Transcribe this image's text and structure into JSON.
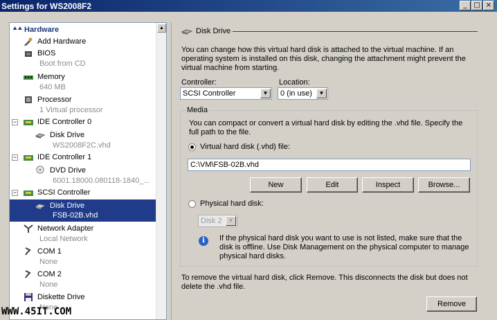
{
  "window": {
    "title": "Settings for WS2008F2"
  },
  "sidebar": {
    "header": "Hardware",
    "items": [
      {
        "label": "Add Hardware",
        "sub": ""
      },
      {
        "label": "BIOS",
        "sub": "Boot from CD"
      },
      {
        "label": "Memory",
        "sub": "640 MB"
      },
      {
        "label": "Processor",
        "sub": "1 Virtual processor"
      },
      {
        "label": "IDE Controller 0",
        "sub": ""
      },
      {
        "label": "Disk Drive",
        "sub": "WS2008F2C.vhd"
      },
      {
        "label": "IDE Controller 1",
        "sub": ""
      },
      {
        "label": "DVD Drive",
        "sub": "6001.18000.080118-1840_..."
      },
      {
        "label": "SCSI Controller",
        "sub": ""
      },
      {
        "label": "Disk Drive",
        "sub": "FSB-02B.vhd"
      },
      {
        "label": "Network Adapter",
        "sub": "Local Network"
      },
      {
        "label": "COM 1",
        "sub": "None"
      },
      {
        "label": "COM 2",
        "sub": "None"
      },
      {
        "label": "Diskette Drive",
        "sub": "None"
      }
    ]
  },
  "main": {
    "section_title": "Disk Drive",
    "intro": "You can change how this virtual hard disk is attached to the virtual machine. If an operating system is installed on this disk, changing the attachment might prevent the virtual machine from starting.",
    "controller_label": "Controller:",
    "controller_value": "SCSI Controller",
    "location_label": "Location:",
    "location_value": "0 (in use)",
    "media": {
      "legend": "Media",
      "description": "You can compact or convert a virtual hard disk by editing the .vhd file. Specify the full path to the file.",
      "vhd_option": "Virtual hard disk (.vhd) file:",
      "vhd_path": "C:\\VM\\FSB-02B.vhd",
      "buttons": {
        "new": "New",
        "edit": "Edit",
        "inspect": "Inspect",
        "browse": "Browse..."
      },
      "physical_option": "Physical hard disk:",
      "physical_value": "Disk 2",
      "info": "If the physical hard disk you want to use is not listed, make sure that the disk is offline. Use Disk Management on the physical computer to manage physical hard disks."
    },
    "remove_text": "To remove the virtual hard disk, click Remove. This disconnects the disk but does not delete the .vhd file.",
    "remove_button": "Remove"
  },
  "watermark": "WWW.45IT.COM",
  "colors": {
    "titlebar": "#0a246a",
    "selection": "#1f3b8a",
    "info": "#2a63c8"
  }
}
